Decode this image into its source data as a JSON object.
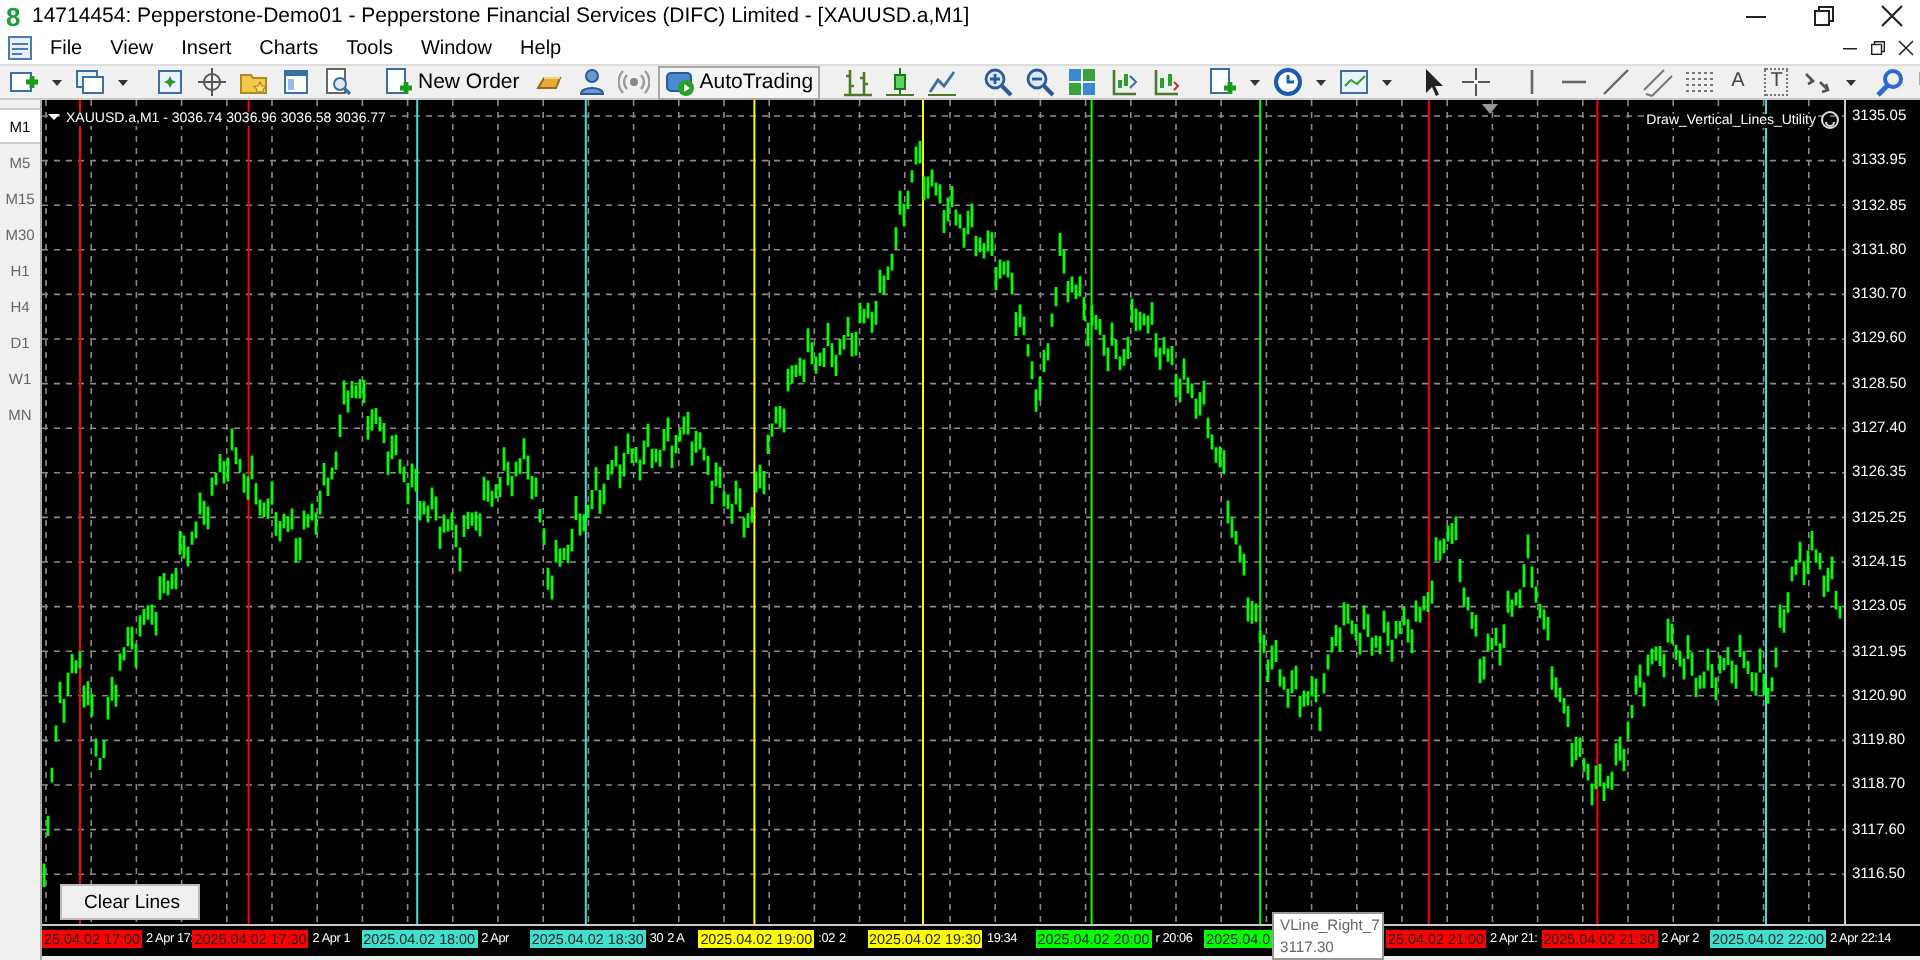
{
  "window": {
    "logo": "8",
    "title": "14714454: Pepperstone-Demo01 - Pepperstone Financial Services (DIFC) Limited - [XAUUSD.a,M1]"
  },
  "menu": [
    "File",
    "View",
    "Insert",
    "Charts",
    "Tools",
    "Window",
    "Help"
  ],
  "toolbar": {
    "new_order": "New Order",
    "autotrading": "AutoTrading",
    "text_tool": "A",
    "label_tool": "T"
  },
  "timeframes": [
    {
      "label": "M1",
      "selected": true
    },
    {
      "label": "M5",
      "selected": false
    },
    {
      "label": "M15",
      "selected": false
    },
    {
      "label": "M30",
      "selected": false
    },
    {
      "label": "H1",
      "selected": false
    },
    {
      "label": "H4",
      "selected": false
    },
    {
      "label": "D1",
      "selected": false
    },
    {
      "label": "W1",
      "selected": false
    },
    {
      "label": "MN",
      "selected": false
    }
  ],
  "chart": {
    "symbol_line": "XAUUSD.a,M1 - 3036.74 3036.96 3036.58 3036.77",
    "expert": "Draw_Vertical_Lines_Utility",
    "price_labels": [
      "3135.05",
      "3133.95",
      "3132.85",
      "3131.80",
      "3130.70",
      "3129.60",
      "3128.50",
      "3127.40",
      "3126.35",
      "3125.25",
      "3124.15",
      "3123.05",
      "3121.95",
      "3120.90",
      "3119.80",
      "3118.70",
      "3117.60",
      "3116.50"
    ],
    "vlines": [
      {
        "color": "#ff0000",
        "label": "25.04.02 17:00",
        "after": [
          "2 Apr 17:"
        ]
      },
      {
        "color": "#ff0000",
        "label": "2025.04.02 17:30",
        "after": [
          "2 Apr 1"
        ]
      },
      {
        "color": "#40e0d0",
        "label": "2025.04.02 18:00",
        "after": [
          "2 Apr"
        ]
      },
      {
        "color": "#40e0d0",
        "label": "2025.04.02 18:30",
        "after": [
          "30",
          "2 A"
        ]
      },
      {
        "color": "#ffff00",
        "label": "2025.04.02 19:00",
        "after": [
          ":02",
          "2"
        ]
      },
      {
        "color": "#ffff00",
        "label": "2025.04.02 19:30",
        "after": [
          "19:34"
        ]
      },
      {
        "color": "#00ff00",
        "label": "2025.04.02 20:00",
        "after": [
          "r 20:06"
        ]
      },
      {
        "color": "#00ff00",
        "label": "2025.04.0"
      },
      {
        "color": "#ff0000",
        "label": "25.04.02 21:00",
        "after": [
          "2 Apr 21:"
        ]
      },
      {
        "color": "#ff0000",
        "label": "2025.04.02 21:30",
        "after": [
          "2 Apr 2"
        ]
      },
      {
        "color": "#40e0d0",
        "label": "2025.04.02 22:00",
        "after": [
          "2 Apr 22:14"
        ]
      }
    ],
    "button": "Clear Lines",
    "tooltip": {
      "name": "VLine_Right_7",
      "price": "3117.30"
    }
  }
}
